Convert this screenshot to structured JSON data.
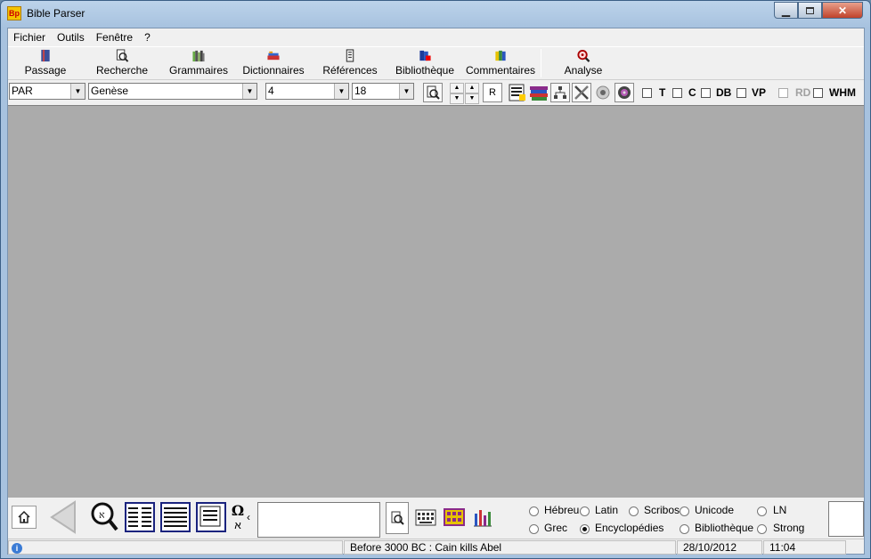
{
  "window": {
    "title": "Bible Parser"
  },
  "menu": [
    "Fichier",
    "Outils",
    "Fenêtre",
    "?"
  ],
  "toolbar": {
    "buttons": [
      {
        "label": "Passage",
        "icon": "book-icon"
      },
      {
        "label": "Recherche",
        "icon": "search-icon"
      },
      {
        "label": "Grammaires",
        "icon": "books-icon"
      },
      {
        "label": "Dictionnaires",
        "icon": "dictionary-icon"
      },
      {
        "label": "Références",
        "icon": "scroll-icon"
      },
      {
        "label": "Bibliothèque",
        "icon": "library-icon"
      },
      {
        "label": "Commentaires",
        "icon": "commentary-icon"
      },
      {
        "label": "Analyse",
        "icon": "analyse-icon"
      }
    ]
  },
  "selectors": {
    "version": "PAR",
    "book": "Genèse",
    "chapter": "4",
    "verse": "18",
    "r_button": "R"
  },
  "checkboxes": [
    {
      "label": "T",
      "enabled": true
    },
    {
      "label": "C",
      "enabled": true
    },
    {
      "label": "DB",
      "enabled": true
    },
    {
      "label": "VP",
      "enabled": true
    },
    {
      "label": "RD",
      "enabled": false
    },
    {
      "label": "WHM",
      "enabled": true
    }
  ],
  "bottom": {
    "omega": "Ω",
    "aleph": "א",
    "chevron": "‹",
    "search_value": "",
    "radios": [
      {
        "label": "Hébreu",
        "checked": false
      },
      {
        "label": "Latin",
        "checked": false
      },
      {
        "label": "Scribos",
        "checked": false
      },
      {
        "label": "Unicode",
        "checked": false
      },
      {
        "label": "LN",
        "checked": false
      },
      {
        "label": "Grec",
        "checked": false
      },
      {
        "label": "Encyclopédies",
        "checked": true
      },
      {
        "label": "Bibliothèque",
        "checked": false
      },
      {
        "label": "Strong",
        "checked": false
      }
    ]
  },
  "status": {
    "info_icon": "i",
    "event": "Before 3000 BC : Cain kills Abel",
    "date": "28/10/2012",
    "time": "11:04"
  },
  "colors": {
    "mdi_background": "#ababab",
    "window_frame": "#a7c2df",
    "close_button": "#c0432b"
  }
}
